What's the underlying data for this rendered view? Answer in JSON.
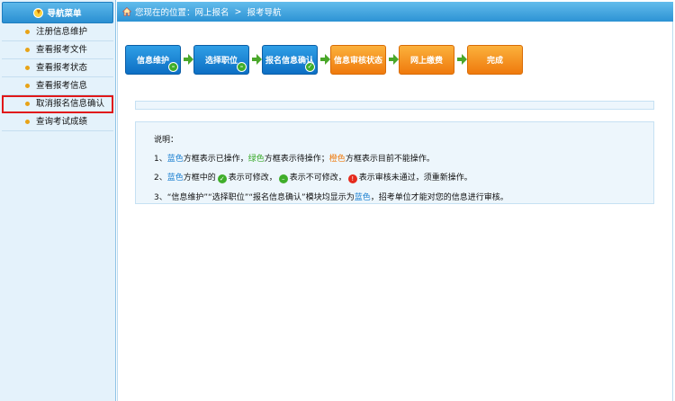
{
  "sidebar": {
    "title": "导航菜单",
    "items": [
      {
        "label": "注册信息维护"
      },
      {
        "label": "查看报考文件"
      },
      {
        "label": "查看报考状态"
      },
      {
        "label": "查看报考信息"
      },
      {
        "label": "取消报名信息确认"
      },
      {
        "label": "查询考试成绩"
      }
    ]
  },
  "breadcrumb": {
    "prefix": "您现在的位置：",
    "items": [
      "网上报名",
      "报考导航"
    ],
    "separator": ">"
  },
  "steps": [
    {
      "label": "信息维护",
      "state": "blue",
      "badge": "–"
    },
    {
      "label": "选择职位",
      "state": "blue",
      "badge": "–"
    },
    {
      "label": "报名信息确认",
      "state": "blue",
      "badge": "✓"
    },
    {
      "label": "信息审核状态",
      "state": "orange"
    },
    {
      "label": "网上缴费",
      "state": "orange"
    },
    {
      "label": "完成",
      "state": "orange"
    }
  ],
  "notes": {
    "title": "说明：",
    "l1": {
      "num": "1、",
      "blue": "蓝色",
      "t1": "方框表示已操作，",
      "green": "绿色",
      "t2": "方框表示待操作；",
      "orange": "橙色",
      "t3": "方框表示目前不能操作。"
    },
    "l2": {
      "num": "2、",
      "blue": "蓝色",
      "t1": "方框中的",
      "t2": "表示可修改，",
      "t3": "表示不可修改，",
      "t4": "表示审核未通过，须重新操作。"
    },
    "l3": {
      "num": "3、",
      "t1": "“信息维护”“选择职位”“报名信息确认”模块均显示为",
      "blue": "蓝色",
      "t2": "，招考单位才能对您的信息进行审核。"
    }
  },
  "colors": {
    "blue": "#1a7fd0",
    "green": "#3aaa2a",
    "orange": "#ef7a0d",
    "highlight": "#e01818"
  },
  "icons": {
    "home": "home-icon",
    "check": "check-icon",
    "minus": "minus-icon",
    "warning": "exclamation-icon"
  }
}
